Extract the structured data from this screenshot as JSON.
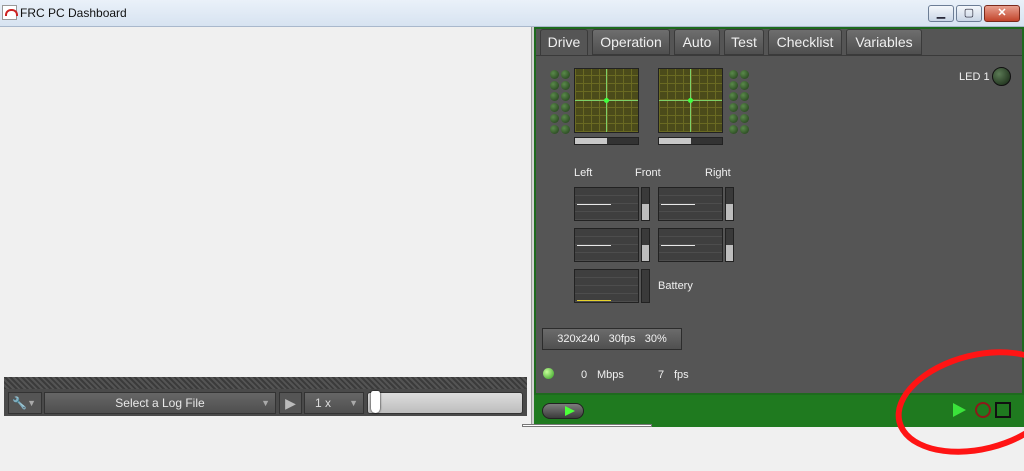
{
  "window": {
    "title": "FRC PC Dashboard",
    "minimize": "▁",
    "maximize": "▢",
    "close": "✕"
  },
  "log_player": {
    "tools_icon": "wrench-icon",
    "file_select_label": "Select a Log File",
    "speed": "1 x",
    "position": 0.0
  },
  "tabs": [
    "Drive",
    "Operation",
    "Auto",
    "Test",
    "Checklist",
    "Variables"
  ],
  "active_tab": "Drive",
  "drive": {
    "joystick_left_x": 0.0,
    "joystick_left_y": 0.0,
    "joystick_right_x": 0.0,
    "joystick_right_y": 0.0,
    "throttle_left": 0.5,
    "throttle_right": 0.5,
    "motor_labels": {
      "left": "Left",
      "front": "Front",
      "right": "Right"
    },
    "battery_label": "Battery",
    "led_label": "LED 1"
  },
  "camera": {
    "resolution": "320x240",
    "fps": "30fps",
    "compression": "30%"
  },
  "stats": {
    "mbps_value": "0",
    "mbps_unit": "Mbps",
    "fps_value": "7",
    "fps_unit": "fps"
  },
  "colors": {
    "accent_green": "#1f7a1f",
    "annotation_red": "#ff1414",
    "panel_bg": "#555555"
  }
}
